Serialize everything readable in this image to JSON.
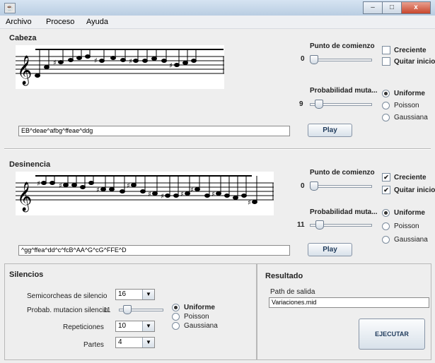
{
  "window": {
    "app_icon": "java-cup-icon",
    "minimize": "–",
    "maximize": "□",
    "close": "x"
  },
  "menu": [
    "Archivo",
    "Proceso",
    "Ayuda"
  ],
  "cabeza": {
    "title": "Cabeza",
    "start_label": "Punto de comienzo",
    "start_value": "0",
    "start_fraction": 0,
    "creciente_label": "Creciente",
    "creciente_checked": false,
    "quitar_label": "Quitar inicio",
    "quitar_checked": false,
    "prob_label": "Probabilidad muta...",
    "prob_value": "9",
    "prob_fraction": 0.09,
    "dist": [
      "Uniforme",
      "Poisson",
      "Gaussiana"
    ],
    "dist_selected": 0,
    "sequence": "EB^deae^afbg^ffeae^ddg",
    "play_label": "Play"
  },
  "desinencia": {
    "title": "Desinencia",
    "start_label": "Punto de comienzo",
    "start_value": "0",
    "start_fraction": 0,
    "creciente_label": "Creciente",
    "creciente_checked": true,
    "quitar_label": "Quitar inicio",
    "quitar_checked": true,
    "prob_label": "Probabilidad muta...",
    "prob_value": "11",
    "prob_fraction": 0.11,
    "dist": [
      "Uniforme",
      "Poisson",
      "Gaussiana"
    ],
    "dist_selected": 0,
    "sequence": "^gg^ffea^dd^c^fcB^AA^G^cG^FFE^D",
    "play_label": "Play"
  },
  "silencios": {
    "title": "Silencios",
    "semicorcheas_label": "Semicorcheas de silencio",
    "semicorcheas_value": "16",
    "prob_label": "Probab. mutacion silencio",
    "prob_value": "11",
    "prob_fraction": 0.11,
    "dist": [
      "Uniforme",
      "Poisson",
      "Gaussiana"
    ],
    "dist_selected": 0,
    "repeticiones_label": "Repeticiones",
    "repeticiones_value": "10",
    "partes_label": "Partes",
    "partes_value": "4"
  },
  "resultado": {
    "title": "Resultado",
    "path_label": "Path de salida",
    "path_value": "Variaciones.mid",
    "ejecutar_label": "EJECUTAR"
  }
}
